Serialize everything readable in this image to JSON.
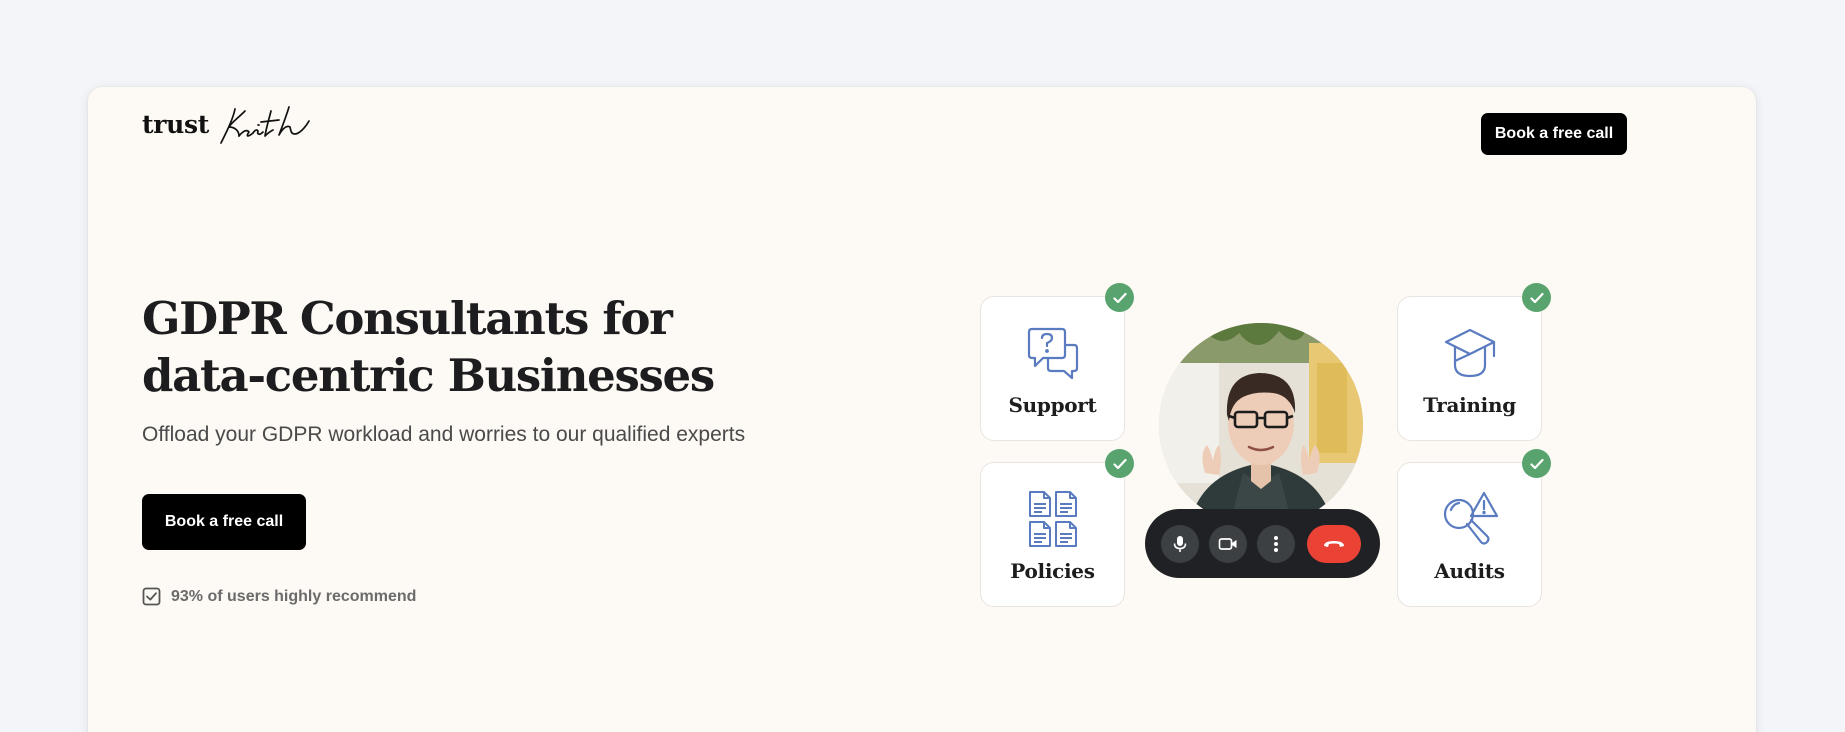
{
  "logo": {
    "brand": "trust",
    "script": "Keith"
  },
  "nav": {
    "cta_label": "Book a free call"
  },
  "hero": {
    "title_line1": "GDPR Consultants for",
    "title_line2": "data-centric Businesses",
    "subtitle": "Offload your GDPR workload and worries to our qualified experts",
    "cta_label": "Book a free call",
    "rating_text": "93% of users highly recommend"
  },
  "services": [
    {
      "label": "Support",
      "icon": "question-chat-icon"
    },
    {
      "label": "Policies",
      "icon": "documents-icon"
    },
    {
      "label": "Training",
      "icon": "graduation-cap-icon"
    },
    {
      "label": "Audits",
      "icon": "magnifier-warning-icon"
    }
  ],
  "video_call": {
    "controls": [
      "microphone-icon",
      "camera-icon",
      "more-options-icon",
      "hang-up-icon"
    ]
  },
  "colors": {
    "page_bg": "#f3f5f9",
    "card_bg": "#fdf9f4",
    "button": "#000000",
    "check": "#59a36e",
    "icon_blue": "#5a7bc0",
    "hang_up": "#ea4335"
  }
}
